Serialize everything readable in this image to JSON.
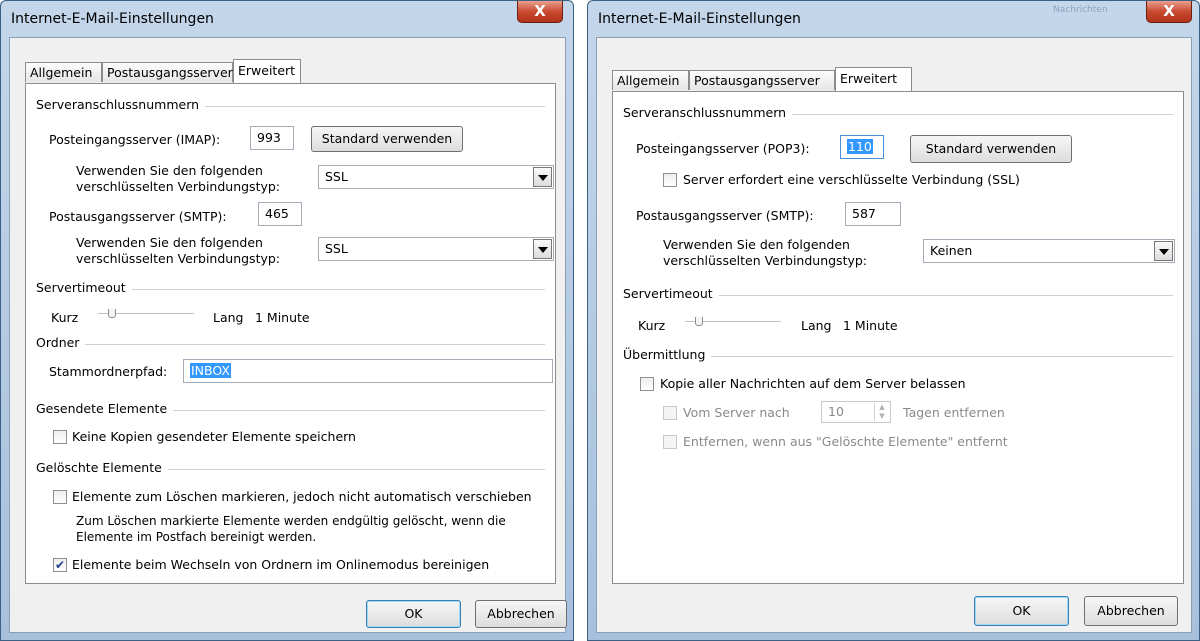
{
  "left": {
    "title": "Internet-E-Mail-Einstellungen",
    "close": "X",
    "tabs": [
      "Allgemein",
      "Postausgangsserver",
      "Erweitert"
    ],
    "ports_group": "Serveranschlussnummern",
    "incoming_label": "Posteingangsserver (IMAP):",
    "incoming_value": "993",
    "standard_button": "Standard verwenden",
    "enc_label_1": "Verwenden Sie den folgenden",
    "enc_label_2": "verschlüsselten Verbindungstyp:",
    "incoming_enc": "SSL",
    "outgoing_label": "Postausgangsserver (SMTP):",
    "outgoing_value": "465",
    "outgoing_enc": "SSL",
    "timeout_group": "Servertimeout",
    "timeout_short": "Kurz",
    "timeout_long": "Lang",
    "timeout_value": "1 Minute",
    "timeout_level": 0.08,
    "folder_group": "Ordner",
    "root_label": "Stammordnerpfad:",
    "root_value": "INBOX",
    "sent_group": "Gesendete Elemente",
    "sent_check": "Keine Kopien gesendeter Elemente speichern",
    "sent_checked": false,
    "deleted_group": "Gelöschte Elemente",
    "deleted_check": "Elemente zum Löschen markieren, jedoch nicht automatisch verschieben",
    "deleted_checked": false,
    "deleted_note_1": "Zum Löschen markierte Elemente werden endgültig gelöscht, wenn die",
    "deleted_note_2": "Elemente im Postfach bereinigt werden.",
    "purge_check": "Elemente beim Wechseln von Ordnern im Onlinemodus bereinigen",
    "purge_checked": true,
    "ok": "OK",
    "cancel": "Abbrechen"
  },
  "right": {
    "title": "Internet-E-Mail-Einstellungen",
    "close": "X",
    "ghost": "Nachrichten",
    "tabs": [
      "Allgemein",
      "Postausgangsserver",
      "Erweitert"
    ],
    "ports_group": "Serveranschlussnummern",
    "incoming_label": "Posteingangsserver (POP3):",
    "incoming_value": "110",
    "standard_button": "Standard verwenden",
    "ssl_check": "Server erfordert eine verschlüsselte Verbindung (SSL)",
    "ssl_checked": false,
    "outgoing_label": "Postausgangsserver (SMTP):",
    "outgoing_value": "587",
    "enc_label_1": "Verwenden Sie den folgenden",
    "enc_label_2": "verschlüsselten Verbindungstyp:",
    "outgoing_enc": "Keinen",
    "timeout_group": "Servertimeout",
    "timeout_short": "Kurz",
    "timeout_long": "Lang",
    "timeout_value": "1 Minute",
    "timeout_level": 0.08,
    "delivery_group": "Übermittlung",
    "keep_copy": "Kopie aller Nachrichten auf dem Server belassen",
    "keep_copy_checked": false,
    "remove_after_pre": "Vom Server nach",
    "remove_after_days": "10",
    "remove_after_post": "Tagen entfernen",
    "remove_deleted": "Entfernen, wenn aus \"Gelöschte Elemente\" entfernt",
    "ok": "OK",
    "cancel": "Abbrechen"
  }
}
